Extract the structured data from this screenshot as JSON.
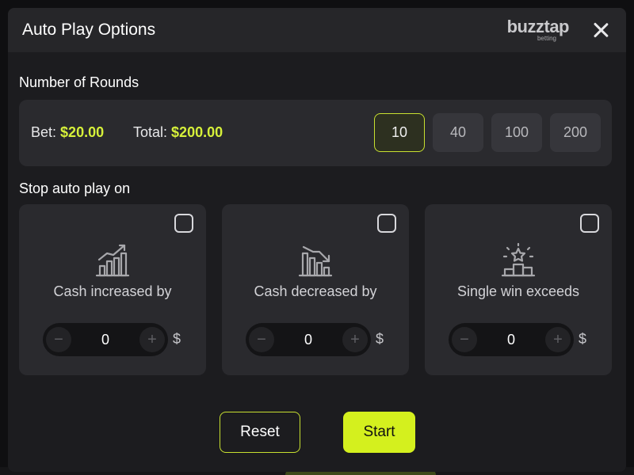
{
  "header": {
    "title": "Auto Play Options",
    "brand_main": "buzztap",
    "brand_sub": "betting"
  },
  "rounds": {
    "label": "Number of Rounds",
    "bet_label": "Bet:",
    "bet_value": "$20.00",
    "total_label": "Total:",
    "total_value": "$200.00",
    "options": [
      "10",
      "40",
      "100",
      "200"
    ],
    "selected": "10"
  },
  "stop": {
    "label": "Stop auto play on",
    "cards": [
      {
        "title": "Cash increased by",
        "icon": "chart-up-icon",
        "value": "0",
        "currency": "$",
        "checked": false
      },
      {
        "title": "Cash decreased by",
        "icon": "chart-down-icon",
        "value": "0",
        "currency": "$",
        "checked": false
      },
      {
        "title": "Single win exceeds",
        "icon": "podium-star-icon",
        "value": "0",
        "currency": "$",
        "checked": false
      }
    ],
    "minus": "−",
    "plus": "+"
  },
  "actions": {
    "reset_label": "Reset",
    "start_label": "Start"
  },
  "colors": {
    "accent": "#d4f01e",
    "panel": "#2a2a2e",
    "header": "#262629"
  }
}
